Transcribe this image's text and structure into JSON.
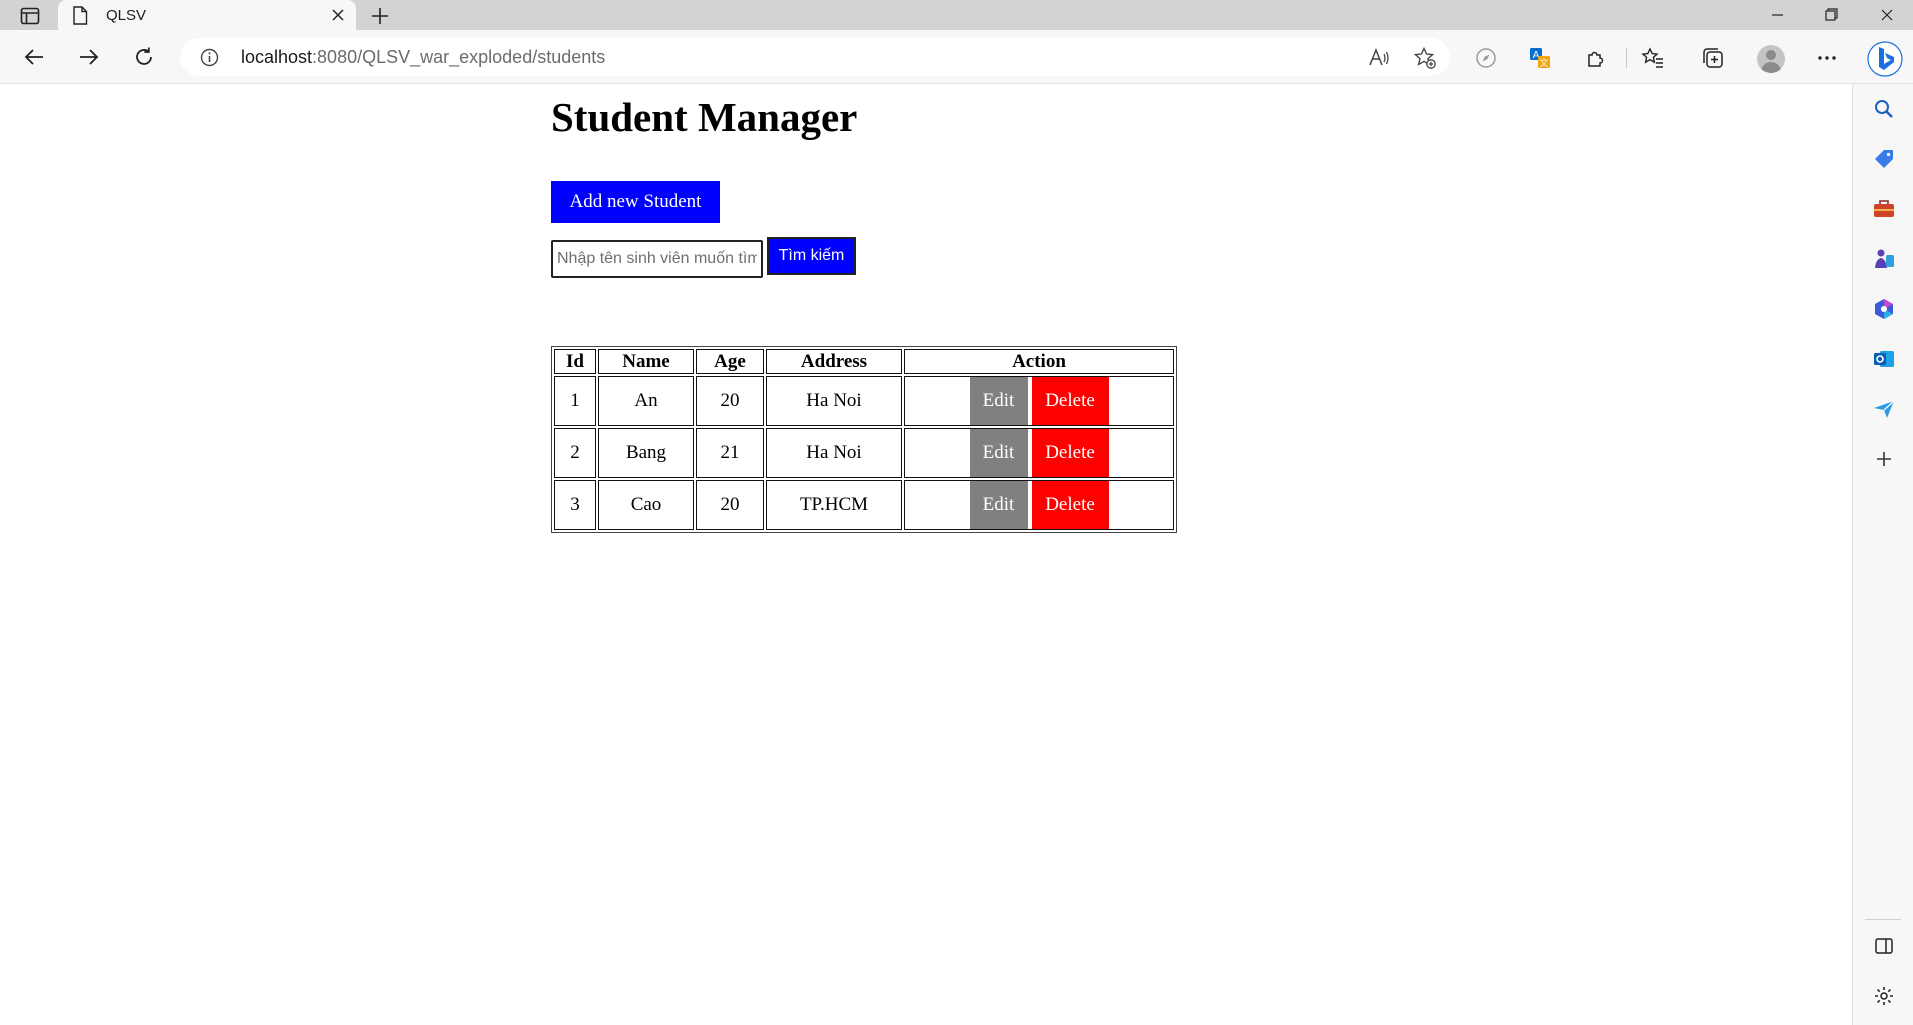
{
  "browser": {
    "tab_title": "QLSV",
    "url_host": "localhost",
    "url_rest": ":8080/QLSV_war_exploded/students"
  },
  "page": {
    "title": "Student Manager",
    "add_button": "Add new Student",
    "search": {
      "placeholder": "Nhập tên sinh viên muốn tìm",
      "button": "Tìm kiếm"
    },
    "table": {
      "headers": {
        "id": "Id",
        "name": "Name",
        "age": "Age",
        "address": "Address",
        "action": "Action"
      },
      "rows": [
        {
          "id": "1",
          "name": "An",
          "age": "20",
          "address": "Ha Noi",
          "edit": "Edit",
          "delete": "Delete"
        },
        {
          "id": "2",
          "name": "Bang",
          "age": "21",
          "address": "Ha Noi",
          "edit": "Edit",
          "delete": "Delete"
        },
        {
          "id": "3",
          "name": "Cao",
          "age": "20",
          "address": "TP.HCM",
          "edit": "Edit",
          "delete": "Delete"
        }
      ]
    }
  },
  "colors": {
    "primary_button": "#0000ff",
    "edit_button": "#808080",
    "delete_button": "#ff0000"
  }
}
